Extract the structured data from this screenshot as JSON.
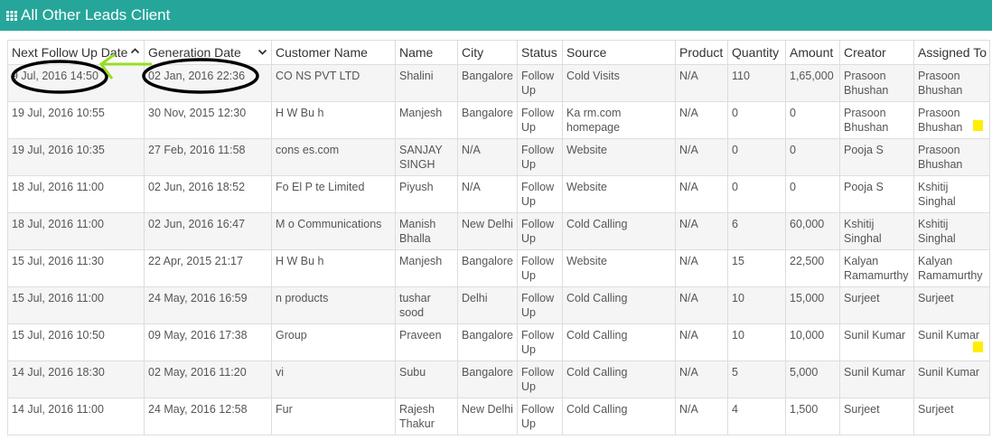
{
  "header": {
    "title": "All Other Leads Client",
    "icon": "grid-icon",
    "background": "#26a69a"
  },
  "table": {
    "columns": [
      {
        "label": "Next Follow Up Date",
        "sort": "ascending"
      },
      {
        "label": "Generation Date",
        "sort": "dropdown"
      },
      {
        "label": "Customer Name"
      },
      {
        "label": "Name"
      },
      {
        "label": "City"
      },
      {
        "label": "Status"
      },
      {
        "label": "Source"
      },
      {
        "label": "Product"
      },
      {
        "label": "Quantity"
      },
      {
        "label": "Amount"
      },
      {
        "label": "Creator"
      },
      {
        "label": "Assigned To"
      }
    ],
    "rows": [
      {
        "next": "9 Jul, 2016 14:50",
        "gen": "02 Jan, 2016 22:36",
        "customer": "CO NS PVT LTD",
        "name": "Shalini",
        "city": "Bangalore",
        "status": "Follow Up",
        "source": "Cold Visits",
        "product": "N/A",
        "quantity": "110",
        "amount": "1,65,000",
        "creator": "Prasoon Bhushan",
        "assigned": "Prasoon Bhushan"
      },
      {
        "next": "19 Jul, 2016 10:55",
        "gen": "30 Nov, 2015 12:30",
        "customer": "H W Bu h",
        "name": "Manjesh",
        "city": "Bangalore",
        "status": "Follow Up",
        "source": "Ka rm.com homepage",
        "product": "N/A",
        "quantity": "0",
        "amount": "0",
        "creator": "Prasoon Bhushan",
        "assigned": "Prasoon Bhushan"
      },
      {
        "next": "19 Jul, 2016 10:35",
        "gen": "27 Feb, 2016 11:58",
        "customer": "cons es.com",
        "name": "SANJAY SINGH",
        "city": "N/A",
        "status": "Follow Up",
        "source": "Website",
        "product": "N/A",
        "quantity": "0",
        "amount": "0",
        "creator": "Pooja S",
        "assigned": "Prasoon Bhushan"
      },
      {
        "next": "18 Jul, 2016 11:00",
        "gen": "02 Jun, 2016 18:52",
        "customer": "Fo El P te Limited",
        "name": "Piyush",
        "city": "N/A",
        "status": "Follow Up",
        "source": "Website",
        "product": "N/A",
        "quantity": "0",
        "amount": "0",
        "creator": "Pooja S",
        "assigned": "Kshitij Singhal"
      },
      {
        "next": "18 Jul, 2016 11:00",
        "gen": "02 Jun, 2016 16:47",
        "customer": "M o Communications",
        "name": "Manish Bhalla",
        "city": "New Delhi",
        "status": "Follow Up",
        "source": "Cold Calling",
        "product": "N/A",
        "quantity": "6",
        "amount": "60,000",
        "creator": "Kshitij Singhal",
        "assigned": "Kshitij Singhal"
      },
      {
        "next": "15 Jul, 2016 11:30",
        "gen": "22 Apr, 2015 21:17",
        "customer": "H W Bu h",
        "name": "Manjesh",
        "city": "Bangalore",
        "status": "Follow Up",
        "source": "Website",
        "product": "N/A",
        "quantity": "15",
        "amount": "22,500",
        "creator": "Kalyan Ramamurthy",
        "assigned": "Kalyan Ramamurthy"
      },
      {
        "next": "15 Jul, 2016 11:00",
        "gen": "24 May, 2016 16:59",
        "customer": "n products",
        "name": "tushar sood",
        "city": "Delhi",
        "status": "Follow Up",
        "source": "Cold Calling",
        "product": "N/A",
        "quantity": "10",
        "amount": "15,000",
        "creator": "Surjeet",
        "assigned": "Surjeet"
      },
      {
        "next": "15 Jul, 2016 10:50",
        "gen": "09 May, 2016 17:38",
        "customer": "Group",
        "name": "Praveen",
        "city": "Bangalore",
        "status": "Follow Up",
        "source": "Cold Calling",
        "product": "N/A",
        "quantity": "10",
        "amount": "10,000",
        "creator": "Sunil Kumar",
        "assigned": "Sunil Kumar"
      },
      {
        "next": "14 Jul, 2016 18:30",
        "gen": "02 May, 2016 11:20",
        "customer": "vi",
        "name": "Subu",
        "city": "Bangalore",
        "status": "Follow Up",
        "source": "Cold Calling",
        "product": "N/A",
        "quantity": "5",
        "amount": "5,000",
        "creator": "Sunil Kumar",
        "assigned": "Sunil Kumar"
      },
      {
        "next": "14 Jul, 2016 11:00",
        "gen": "24 May, 2016 12:58",
        "customer": "Fur",
        "name": "Rajesh Thakur",
        "city": "New Delhi",
        "status": "Follow Up",
        "source": "Cold Calling",
        "product": "N/A",
        "quantity": "4",
        "amount": "1,500",
        "creator": "Surjeet",
        "assigned": "Surjeet"
      }
    ]
  },
  "annotations": {
    "circle_color": "#000000",
    "arrow_color": "#99dd22",
    "highlight_color": "#ffee00"
  }
}
